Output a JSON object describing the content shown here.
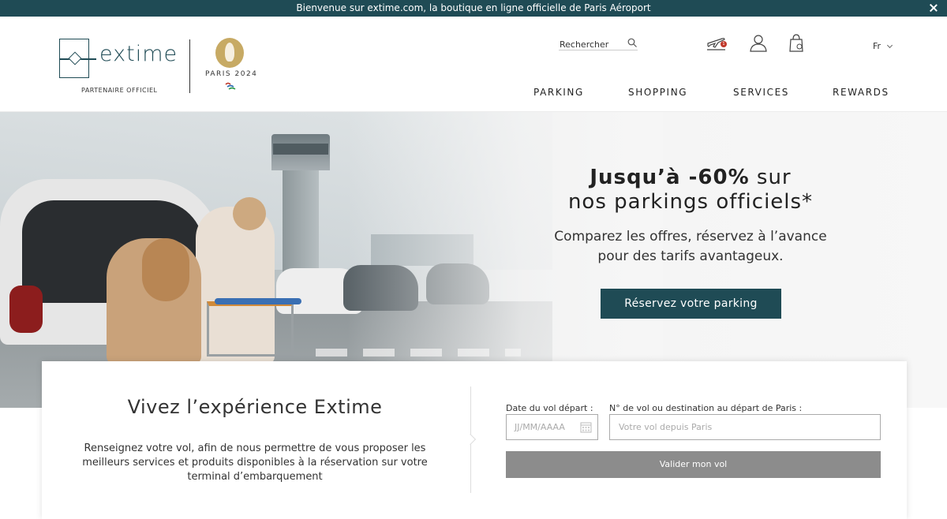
{
  "topbar": {
    "message": "Bienvenue sur extime.com, la boutique en ligne officielle de Paris Aéroport"
  },
  "header": {
    "brand": "extime",
    "partner_label": "PARTENAIRE OFFICIEL",
    "paris_label": "PARIS 2024",
    "search_label": "Rechercher",
    "flight_badge": "1",
    "language": "Fr",
    "nav": [
      "PARKING",
      "SHOPPING",
      "SERVICES",
      "REWARDS"
    ]
  },
  "hero": {
    "title_bold": "Jusqu’à -60%",
    "title_rest": "sur",
    "title_line2": "nos parkings officiels*",
    "subtitle_line1": "Comparez les offres, réservez à l’avance",
    "subtitle_line2": "pour des tarifs avantageux.",
    "cta": "Réservez votre parking"
  },
  "flight_panel": {
    "title": "Vivez l’expérience Extime",
    "description": "Renseignez votre vol, afin de nous permettre de vous proposer les meilleurs services et produits disponibles à la réservation sur votre terminal d’embarquement",
    "date_label": "Date du vol départ :",
    "date_placeholder": "JJ/MM/AAAA",
    "flight_label": "N° de vol ou destination au départ de Paris :",
    "flight_placeholder": "Votre vol depuis Paris",
    "submit": "Valider mon vol"
  },
  "colors": {
    "brand": "#1f4b55",
    "gold": "#c7aa64",
    "button_grey": "#8c8c8c"
  },
  "icons": [
    "close-icon",
    "search-icon",
    "flight-icon",
    "user-icon",
    "bag-icon",
    "chevron-down-icon",
    "calendar-icon"
  ]
}
